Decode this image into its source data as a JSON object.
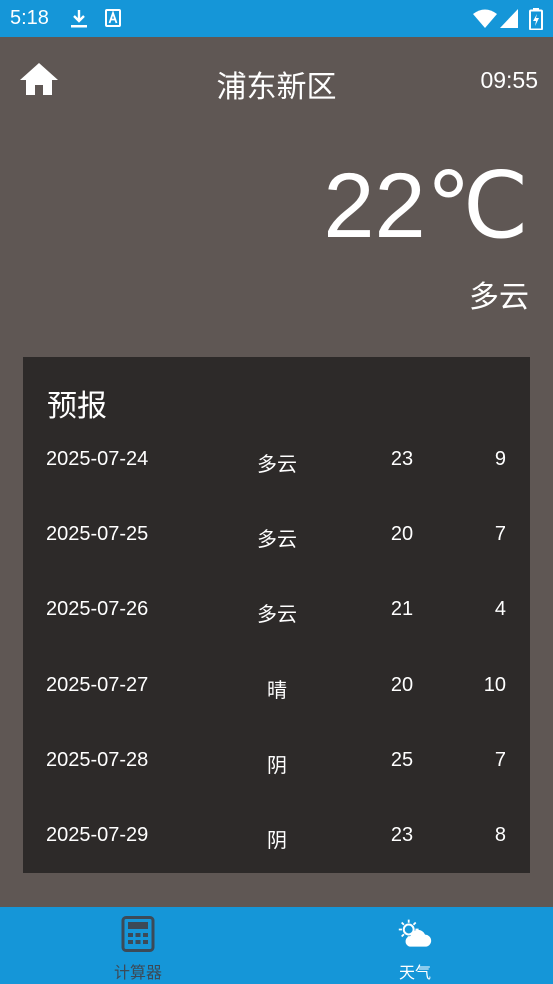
{
  "status_bar": {
    "time": "5:18",
    "icons": [
      "download-icon",
      "app-a-icon",
      "wifi-icon",
      "signal-icon",
      "battery-icon"
    ]
  },
  "header": {
    "city": "浦东新区",
    "time": "09:55",
    "home_icon": "home-icon"
  },
  "current": {
    "temperature": "22℃",
    "condition": "多云"
  },
  "forecast": {
    "title": "预报",
    "rows": [
      {
        "date": "2025-07-24",
        "condition": "多云",
        "high": "23",
        "low": "9"
      },
      {
        "date": "2025-07-25",
        "condition": "多云",
        "high": "20",
        "low": "7"
      },
      {
        "date": "2025-07-26",
        "condition": "多云",
        "high": "21",
        "low": "4"
      },
      {
        "date": "2025-07-27",
        "condition": "晴",
        "high": "20",
        "low": "10"
      },
      {
        "date": "2025-07-28",
        "condition": "阴",
        "high": "25",
        "low": "7"
      },
      {
        "date": "2025-07-29",
        "condition": "阴",
        "high": "23",
        "low": "8"
      }
    ]
  },
  "tabs": [
    {
      "label": "计算器",
      "icon": "calculator-icon",
      "active": false
    },
    {
      "label": "天气",
      "icon": "weather-icon",
      "active": true
    }
  ],
  "colors": {
    "status_bar": "#1596d8",
    "background": "#5f5754",
    "forecast_panel": "#2d2a29",
    "tab_inactive": "#3c4a57",
    "tab_active": "#ffffff"
  }
}
